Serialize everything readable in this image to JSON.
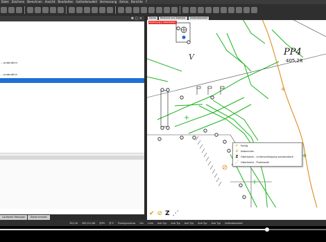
{
  "menu": [
    "Datei",
    "Zeichnen",
    "Berechnen",
    "Ansicht",
    "Bearbeiten",
    "Geländemodell",
    "Vermessung",
    "Extras",
    "Berichte",
    "?"
  ],
  "left_panel": {
    "header_controls": "✱ ▢ ✕",
    "items": [
      {
        "label": "",
        "selected": false
      },
      {
        "label": "",
        "selected": false
      },
      {
        "label": "",
        "selected": false
      },
      {
        "label": "",
        "selected": false
      },
      {
        "label": "",
        "selected": false
      },
      {
        "label": "",
        "selected": false
      },
      {
        "label": "",
        "selected": false
      },
      {
        "label": "…undeutlich",
        "selected": false
      },
      {
        "label": "",
        "selected": false
      },
      {
        "label": "…undeutlich",
        "selected": false
      },
      {
        "label": "",
        "selected": true
      }
    ],
    "tabs": [
      "Laufwerk-Manager",
      "Datenverwalt."
    ]
  },
  "map": {
    "tabs": [
      "Demo",
      "Bestand und Kataster",
      "Geländemodell"
    ],
    "status_label": "Zeichnung 1 / Bearbeiten",
    "point_label": "PP4",
    "point_value": "405,28",
    "v_label": "V",
    "context_menu": [
      {
        "icon": "checkmark-icon",
        "glyph": "✔",
        "label": "Fertig",
        "color": "#caa000"
      },
      {
        "icon": "cancel-icon",
        "glyph": "⊘",
        "label": "Abbrechen",
        "color": "#caa000"
      },
      {
        "icon": "z-line-icon",
        "glyph": "Z",
        "label": "Oberkante - Linienverfolgung automatisch",
        "color": "#111111"
      },
      {
        "icon": "dotted-line-icon",
        "glyph": "⋰",
        "label": "Oberkante - Punktwahl",
        "color": "#111111"
      }
    ],
    "footer_icons": [
      {
        "name": "checkmark-icon",
        "glyph": "✔",
        "color": "#caa000"
      },
      {
        "name": "cancel-icon",
        "glyph": "⊘",
        "color": "#caa000"
      },
      {
        "name": "z-line-icon",
        "glyph": "Z",
        "color": "#111111"
      },
      {
        "name": "dotted-line-icon",
        "glyph": "⋰",
        "color": "#111111"
      }
    ]
  },
  "status_bar": [
    "350,28",
    "289,312,88",
    "@PX",
    "@ Z",
    "Punktgrundriss",
    "Hin",
    "Linie",
    "Anb Typ",
    "Anb Typ",
    "Anb Typ",
    "Anb Typ",
    "Anb Typ",
    "Geländemodell"
  ],
  "video": {
    "progress": 0.82
  },
  "colors": {
    "accent_selection": "#1f6fd6",
    "map_status": "#e53935",
    "green_lines": "#1db31d",
    "orange_line": "#e08a1e"
  }
}
